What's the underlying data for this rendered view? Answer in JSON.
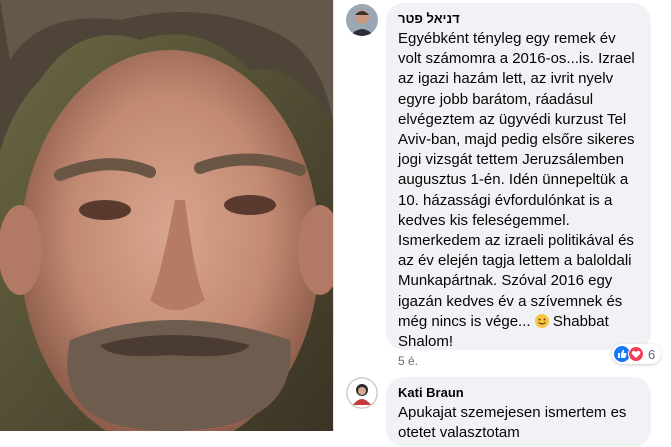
{
  "comments": [
    {
      "author": "דניאל פטר",
      "text": "Egyébként tényleg egy remek év\nvolt számomra a 2016-os...is. Izrael\naz igazi hazám lett, az ivrit nyelv\negyre jobb barátom, ráadásul\nelvégeztem az ügyvédi kurzust Tel\nAviv-ban, majd pedig elsőre sikeres\njogi vizsgát tettem Jeruzsálemben\naugusztus 1-én. Idén ünnepeltük a\n10. házassági évfordulónkat is a\nkedves kis feleségemmel.\nIsmerkedem az izraeli politikával és\naz év elején tagja lettem a baloldali\nMunkapártnak. Szóval 2016 egy\nigazán kedves év a szívemnek és\nmég nincs is vége...",
      "text_tail": " Shabbat\nShalom!",
      "time": "5 é.",
      "reaction_count": "6"
    },
    {
      "author": "Kati Braun",
      "text": "Apukajat szemejesen ismertem es\notetet valasztotam"
    }
  ],
  "colors": {
    "bubble": "#f0f2f5",
    "like": "#1877f2",
    "love": "#f33e58",
    "meta": "#65676b"
  },
  "icons": [
    "avatar-photo",
    "like-icon",
    "love-icon",
    "smile-emoji-icon"
  ]
}
